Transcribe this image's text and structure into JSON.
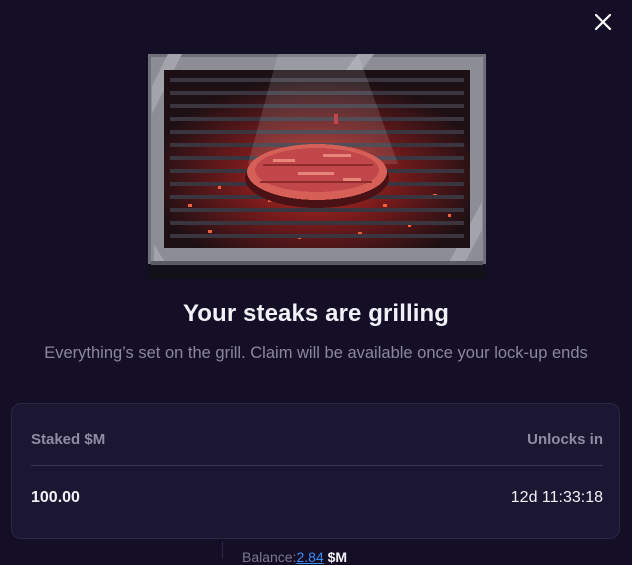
{
  "modal": {
    "close_icon": "close-icon",
    "illustration": "grilling-steak-illustration",
    "title": "Your steaks are grilling",
    "subtitle": "Everything’s set on the grill. Claim will be available once your lock-up ends"
  },
  "stake_card": {
    "staked_label": "Staked $M",
    "unlocks_label": "Unlocks in",
    "staked_value": "100.00",
    "unlocks_value": "12d 11:33:18"
  },
  "background": {
    "balance_label": "Balance:",
    "balance_amount": "2.84",
    "balance_unit": "$M"
  },
  "colors": {
    "background": "#140f26",
    "card": "#1b1631",
    "title": "#f2f1f7",
    "muted": "#8b879e",
    "link": "#3d8bf5"
  }
}
